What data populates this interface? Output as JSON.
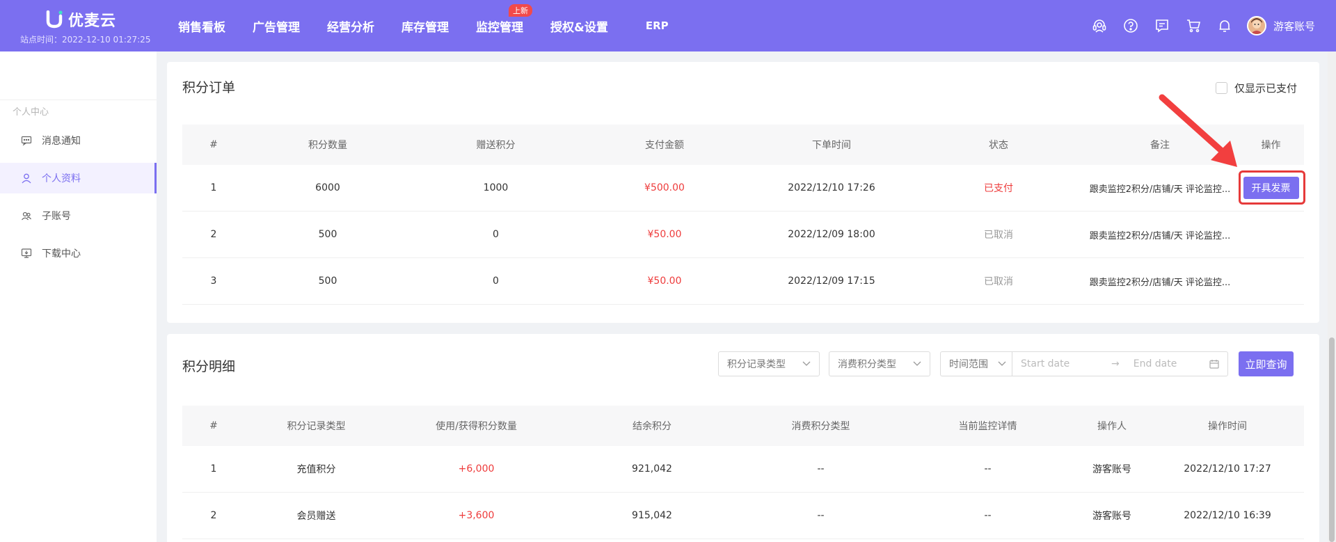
{
  "header": {
    "logo_text": "优麦云",
    "site_time": "站点时间：2022-12-10 01:27:25",
    "nav": [
      "销售看板",
      "广告管理",
      "经营分析",
      "库存管理",
      "监控管理",
      "授权&设置",
      "ERP"
    ],
    "nav_badge": "上新",
    "user_name": "游客账号",
    "accent_color": "#7b6ff0"
  },
  "sidebar": {
    "group_label": "个人中心",
    "items": [
      {
        "label": "消息通知",
        "icon": "message-icon"
      },
      {
        "label": "个人资料",
        "icon": "user-icon",
        "active": true
      },
      {
        "label": "子账号",
        "icon": "sub-account-icon"
      },
      {
        "label": "下载中心",
        "icon": "download-icon"
      }
    ]
  },
  "orders": {
    "title": "积分订单",
    "only_paid_label": "仅显示已支付",
    "columns": [
      "#",
      "积分数量",
      "赠送积分",
      "支付金额",
      "下单时间",
      "状态",
      "备注",
      "操作"
    ],
    "rows": [
      {
        "no": "1",
        "points": "6000",
        "bonus": "1000",
        "amount": "¥500.00",
        "time": "2022/12/10 17:26",
        "status": "已支付",
        "note": "跟卖监控2积分/店铺/天 评论监控...",
        "action": "开具发票"
      },
      {
        "no": "2",
        "points": "500",
        "bonus": "0",
        "amount": "¥50.00",
        "time": "2022/12/09 18:00",
        "status": "已取消",
        "note": "跟卖监控2积分/店铺/天 评论监控...",
        "action": ""
      },
      {
        "no": "3",
        "points": "500",
        "bonus": "0",
        "amount": "¥50.00",
        "time": "2022/12/09 17:15",
        "status": "已取消",
        "note": "跟卖监控2积分/店铺/天 评论监控...",
        "action": ""
      }
    ]
  },
  "details": {
    "title": "积分明细",
    "filters": {
      "record_type": "积分记录类型",
      "consume_type": "消费积分类型",
      "time_range": "时间范围",
      "start_placeholder": "Start date",
      "end_placeholder": "End date",
      "query_label": "立即查询"
    },
    "columns": [
      "#",
      "积分记录类型",
      "使用/获得积分数量",
      "结余积分",
      "消费积分类型",
      "当前监控详情",
      "操作人",
      "操作时间"
    ],
    "rows": [
      {
        "no": "1",
        "type": "充值积分",
        "change": "+6,000",
        "balance": "921,042",
        "consume_type": "--",
        "monitor": "--",
        "operator": "游客账号",
        "time": "2022/12/10 17:27"
      },
      {
        "no": "2",
        "type": "会员赠送",
        "change": "+3,600",
        "balance": "915,042",
        "consume_type": "--",
        "monitor": "--",
        "operator": "游客账号",
        "time": "2022/12/10 16:39"
      }
    ]
  }
}
